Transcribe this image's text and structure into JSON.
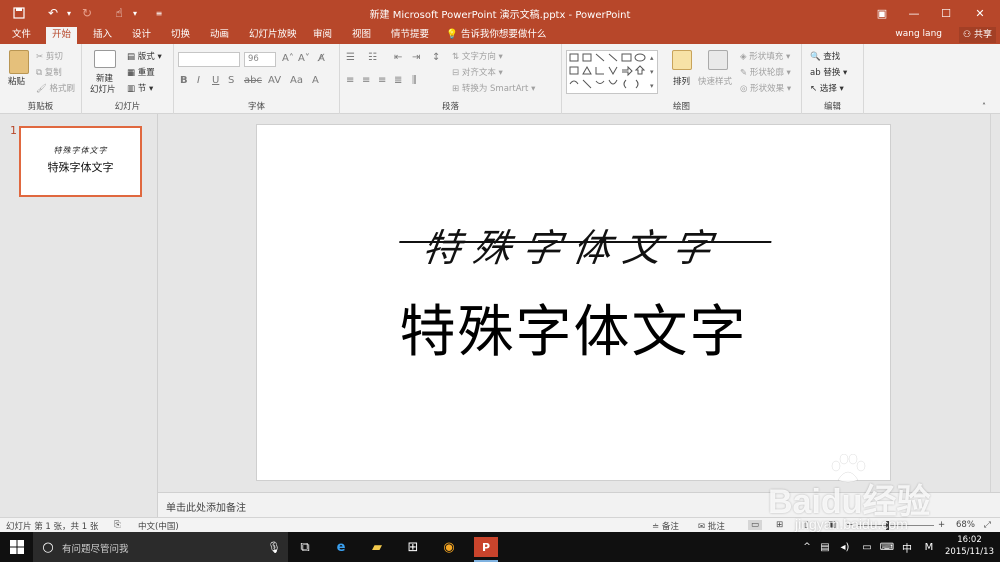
{
  "window": {
    "title": "新建 Microsoft PowerPoint 演示文稿.pptx - PowerPoint",
    "accent": "#b7472a"
  },
  "quick_access": [
    "save-icon",
    "undo-icon",
    "redo-icon",
    "touch-mode-icon",
    "customize-icon"
  ],
  "tabs": [
    "文件",
    "开始",
    "插入",
    "设计",
    "切换",
    "动画",
    "幻灯片放映",
    "审阅",
    "视图",
    "情节提要"
  ],
  "active_tab": "开始",
  "tell_me": "告诉我你想要做什么",
  "user": "wang lang",
  "share": "共享",
  "ribbon": {
    "clipboard": {
      "paste": "粘贴",
      "cut": "剪切",
      "copy": "复制",
      "format_painter": "格式刷",
      "label": "剪贴板"
    },
    "slides": {
      "new_slide_1": "新建",
      "new_slide_2": "幻灯片",
      "layout": "版式",
      "reset": "重置",
      "section": "节",
      "label": "幻灯片"
    },
    "font": {
      "size": "96",
      "label": "字体"
    },
    "paragraph": {
      "text_direction": "文字方向",
      "align_text": "对齐文本",
      "convert_smartart": "转换为 SmartArt",
      "label": "段落"
    },
    "drawing": {
      "arrange": "排列",
      "quick_styles": "快速样式",
      "shape_fill": "形状填充",
      "shape_outline": "形状轮廓",
      "shape_effects": "形状效果",
      "label": "绘图"
    },
    "editing": {
      "find": "查找",
      "replace": "替换",
      "select": "选择",
      "label": "编辑"
    }
  },
  "thumbnails": [
    {
      "number": "1",
      "line1": "特殊字体文字",
      "line2": "特殊字体文字"
    }
  ],
  "slide": {
    "line1": "特殊字体文字",
    "line2": "特殊字体文字"
  },
  "notes_placeholder": "单击此处添加备注",
  "status": {
    "slide_info": "幻灯片 第 1 张，共 1 张",
    "language": "中文(中国)",
    "notes": "备注",
    "comments": "批注",
    "zoom": "68%"
  },
  "taskbar": {
    "search_placeholder": "有问题尽管问我",
    "ime": "中",
    "time": "16:02",
    "date": "2015/11/13"
  },
  "watermark": {
    "brand": "Baidu经验",
    "url": "jingyan.baidu.com"
  }
}
